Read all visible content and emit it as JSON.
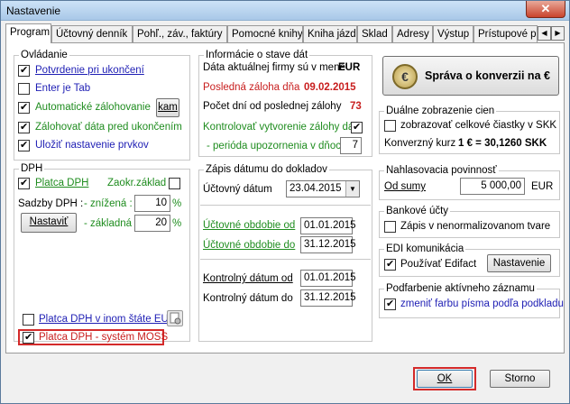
{
  "window": {
    "title": "Nastavenie",
    "close_glyph": "✕"
  },
  "tabs": [
    {
      "label": "Program",
      "selected": true
    },
    {
      "label": "Účtovný denník"
    },
    {
      "label": "Pohľ., záv., faktúry"
    },
    {
      "label": "Pomocné knihy"
    },
    {
      "label": "Kniha jázd"
    },
    {
      "label": "Sklad"
    },
    {
      "label": "Adresy"
    },
    {
      "label": "Výstup"
    },
    {
      "label": "Prístupové pr"
    }
  ],
  "tab_arrows": {
    "left": "◀",
    "right": "▶"
  },
  "ovladanie": {
    "title": "Ovládanie",
    "items": [
      {
        "label": "Potvrdenie pri ukončení",
        "checked": true
      },
      {
        "label": "Enter je Tab",
        "checked": false
      },
      {
        "label": "Automatické zálohovanie",
        "checked": true
      },
      {
        "label": "Zálohovať dáta pred ukončením",
        "checked": true
      },
      {
        "label": "Uložiť nastavenie prvkov",
        "checked": true
      }
    ],
    "kam_button": "kam"
  },
  "dph": {
    "title": "DPH",
    "platca_label": "Platca DPH",
    "platca_checked": true,
    "zaokr_label": "Zaokr.základ",
    "zaokr_checked": false,
    "sadzby_label": "Sadzby DPH :",
    "znizena_label": "- znížená :",
    "znizena_value": "10",
    "zakladna_label": "- základná :",
    "zakladna_value": "20",
    "percent": "%",
    "nastavit_button": "Nastaviť"
  },
  "eu_platca": {
    "label": "Platca DPH v inom štáte EU",
    "checked": false
  },
  "moss": {
    "label": "Platca DPH - systém MOSS",
    "checked": true,
    "highlight": "#d42a2a"
  },
  "info": {
    "title": "Informácie o stave dát",
    "currency_label": "Dáta aktuálnej firmy sú v mene",
    "currency_value": "EUR",
    "last_backup_label": "Posledná záloha dňa",
    "last_backup_value": "09.02.2015",
    "days_label": "Počet dní od poslednej zálohy",
    "days_value": "73",
    "control_label": "Kontrolovať vytvorenie zálohy dát",
    "control_checked": true,
    "period_label": "- perióda upozornenia v dňoch",
    "period_value": "7"
  },
  "zapis": {
    "title": "Zápis dátumu do dokladov",
    "uctovny_datum_label": "Účtovný dátum",
    "uctovny_datum_value": "23.04.2015",
    "obdobie_od_label": "Účtovné obdobie od",
    "obdobie_od_value": "01.01.2015",
    "obdobie_do_label": "Účtovné obdobie do",
    "obdobie_do_value": "31.12.2015",
    "kontrolny_od_label": "Kontrolný dátum od",
    "kontrolny_od_value": "01.01.2015",
    "kontrolny_do_label": "Kontrolný dátum do",
    "kontrolny_do_value": "31.12.2015"
  },
  "konverzia": {
    "label": "Správa o konverzii na €",
    "icon_glyph": "€"
  },
  "duale": {
    "title": "Duálne zobrazenie cien",
    "checkbox_label": "zobrazovať celkové čiastky v SKK",
    "checked": false,
    "kurz_label": "Konverzný kurz",
    "kurz_value": "1 € = 30,1260 SKK"
  },
  "nahlasovacia": {
    "title": "Nahlasovacia povinnosť",
    "od_sumy_label": "Od sumy",
    "od_sumy_value": "5 000,00",
    "currency": "EUR"
  },
  "bankove": {
    "title": "Bankové účty",
    "checkbox_label": "Zápis v nenormalizovanom tvare",
    "checked": false
  },
  "edi": {
    "title": "EDI komunikácia",
    "checkbox_label": "Používať Edifact",
    "checked": true,
    "button": "Nastavenie"
  },
  "podfarbenie": {
    "title": "Podfarbenie aktívneho záznamu",
    "checkbox_label": "zmeniť farbu písma podľa podkladu",
    "checked": true
  },
  "buttons": {
    "ok": "OK",
    "storno": "Storno"
  },
  "colors": {
    "accent_blue": "#1e1eb4",
    "accent_green": "#1e8c1e",
    "accent_red": "#c81e1e",
    "highlight_red": "#d42a2a"
  }
}
